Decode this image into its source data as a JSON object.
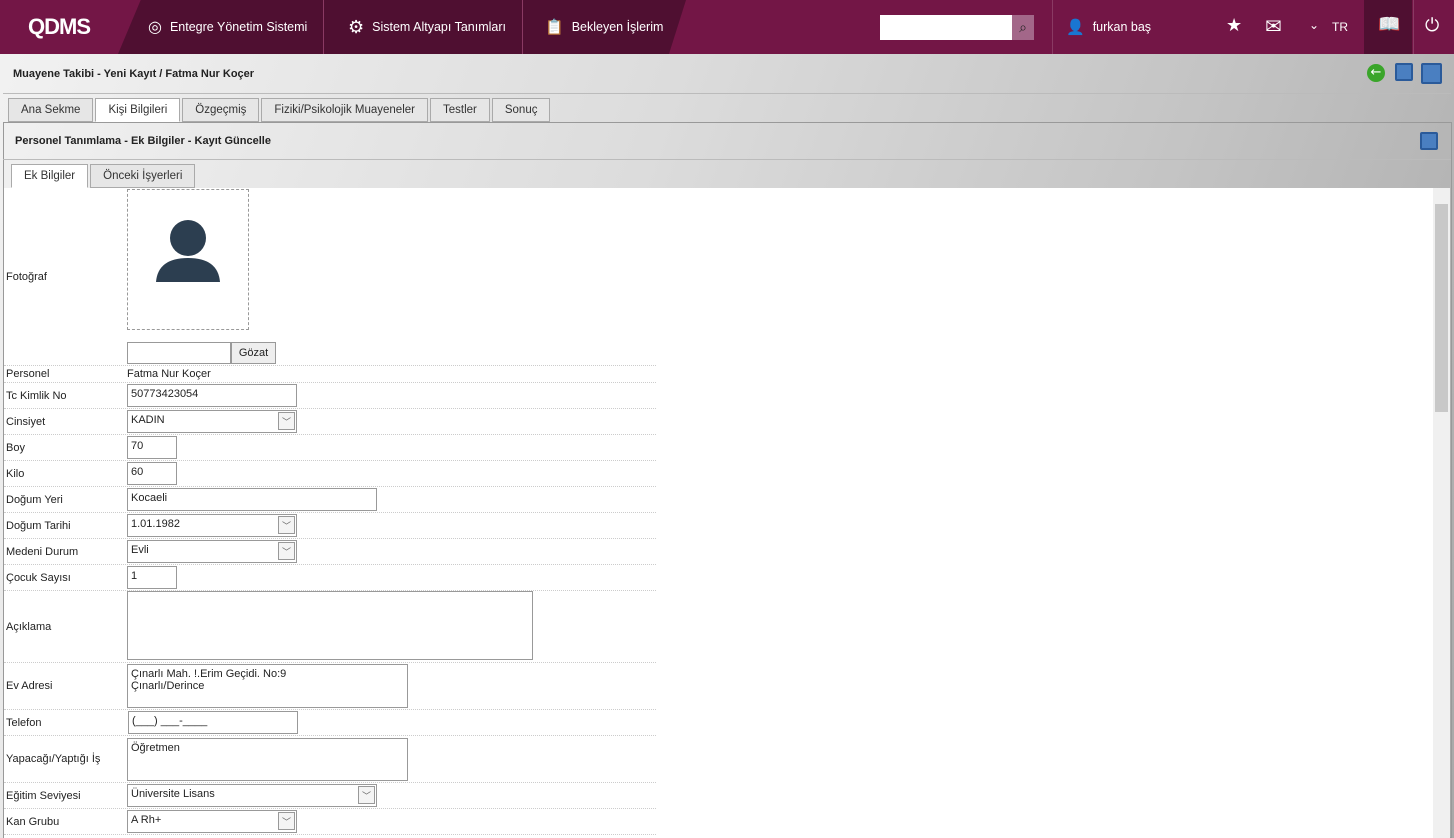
{
  "header": {
    "logo": "QDMS",
    "nav": [
      "Entegre Yönetim Sistemi",
      "Sistem Altyapı Tanımları",
      "Bekleyen İşlerim"
    ],
    "search_placeholder": "",
    "user": "furkan baş",
    "language": "TR"
  },
  "page": {
    "title": "Muayene Takibi - Yeni Kayıt / Fatma Nur Koçer",
    "tabs": [
      "Ana Sekme",
      "Kişi Bilgileri",
      "Özgeçmiş",
      "Fiziki/Psikolojik Muayeneler",
      "Testler",
      "Sonuç"
    ],
    "active_tab": "Kişi Bilgileri"
  },
  "panel": {
    "title": "Personel Tanımlama - Ek Bilgiler - Kayıt Güncelle",
    "tabs": [
      "Ek Bilgiler",
      "Önceki İşyerleri"
    ]
  },
  "form": {
    "photo_label": "Fotoğraf",
    "browse_button": "Gözat",
    "personel_label": "Personel",
    "personel": "Fatma Nur Koçer",
    "tc_label": "Tc Kimlik No",
    "tc": "50773423054",
    "cinsiyet_label": "Cinsiyet",
    "cinsiyet": "KADIN",
    "boy_label": "Boy",
    "boy": "70",
    "kilo_label": "Kilo",
    "kilo": "60",
    "dogum_yeri_label": "Doğum Yeri",
    "dogum_yeri": "Kocaeli",
    "dogum_tarihi_label": "Doğum Tarihi",
    "dogum_tarihi": "1.01.1982",
    "medeni_label": "Medeni Durum",
    "medeni": "Evli",
    "cocuk_label": "Çocuk Sayısı",
    "cocuk": "1",
    "aciklama_label": "Açıklama",
    "aciklama": "",
    "adres_label": "Ev Adresi",
    "adres": "Çınarlı Mah. !.Erim Geçidi. No:9\nÇınarlı/Derince",
    "telefon_label": "Telefon",
    "telefon": "(___) ___-____",
    "is_label": "Yapacağı/Yaptığı İş",
    "is": "Öğretmen",
    "egitim_label": "Eğitim Seviyesi",
    "egitim": "Üniversite Lisans",
    "kan_label": "Kan Grubu",
    "kan": "A Rh+"
  }
}
